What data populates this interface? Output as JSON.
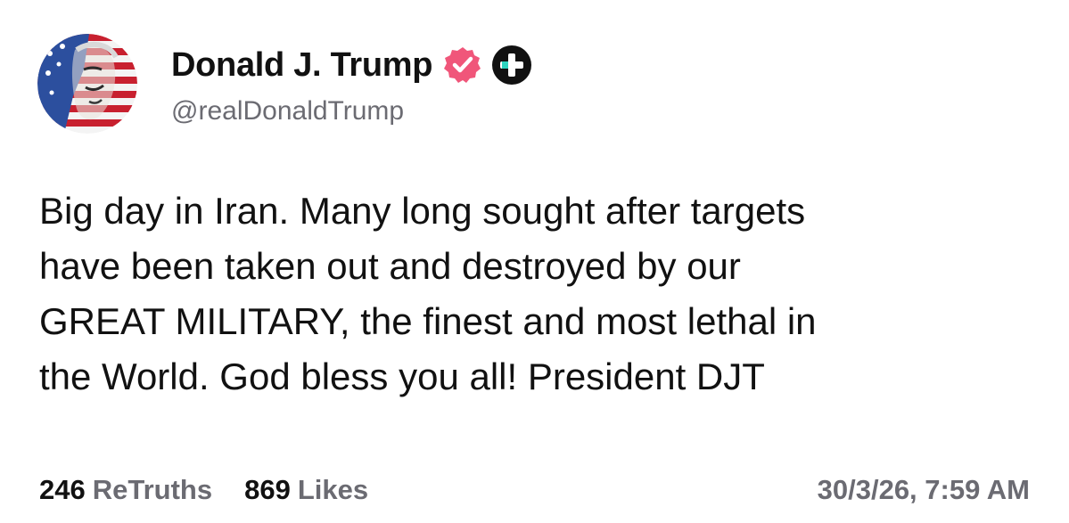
{
  "author": {
    "display_name": "Donald J. Trump",
    "handle": "@realDonaldTrump",
    "avatar_icon": "flag-portrait-avatar",
    "verified_icon": "verified-badge-icon",
    "verified_color": "#f0567a",
    "plus_icon": "plus-badge-icon"
  },
  "post": {
    "lines": [
      "Big day in Iran. Many long sought after targets",
      "have been taken out and destroyed by our",
      "GREAT MILITARY, the finest and most lethal in",
      "the World. God bless you all! President DJT"
    ]
  },
  "stats": {
    "retruths_count": "246",
    "retruths_label": "ReTruths",
    "likes_count": "869",
    "likes_label": "Likes"
  },
  "timestamp": "30/3/26, 7:59 AM",
  "colors": {
    "text": "#111111",
    "muted": "#6b6b72",
    "background": "#ffffff"
  }
}
